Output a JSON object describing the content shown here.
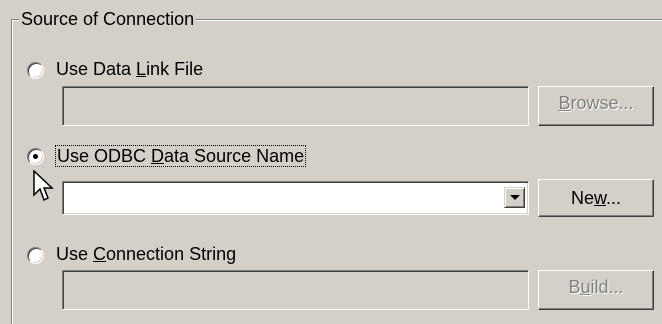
{
  "group": {
    "title": "Source of Connection"
  },
  "options": {
    "data_link": {
      "label_pre": "Use Data ",
      "label_key": "L",
      "label_post": "ink File",
      "selected": false,
      "path_value": "",
      "button_pre": "",
      "button_key": "B",
      "button_post": "rowse...",
      "button_enabled": false
    },
    "odbc": {
      "label_pre": "Use ODBC ",
      "label_key": "D",
      "label_post": "ata Source Name",
      "selected": true,
      "dsn_value": "",
      "button_pre": "Ne",
      "button_key": "w",
      "button_post": "...",
      "button_enabled": true
    },
    "conn_string": {
      "label_pre": "Use ",
      "label_key": "C",
      "label_post": "onnection String",
      "selected": false,
      "value": "",
      "button_pre": "B",
      "button_key": "u",
      "button_post": "ild...",
      "button_enabled": false
    }
  },
  "icons": {
    "dropdown": "chevron-down-icon",
    "cursor": "mouse-pointer-icon"
  },
  "colors": {
    "face": "#d4d0c8",
    "disabled_text": "#808080"
  }
}
